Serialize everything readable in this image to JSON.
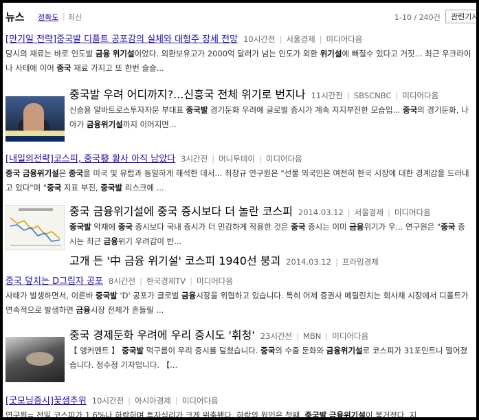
{
  "header": {
    "title": "뉴스",
    "tab_accuracy": "정확도",
    "separator": "|",
    "tab_latest": "최신",
    "result_count": "1-10 / 240건",
    "related_button": "관련기사"
  },
  "items": [
    {
      "title": "[만기일 전략]중국발 디플트 공포감의 실체와 대형주 장세 전망",
      "time": "10시간전",
      "source": "서울경제",
      "via": "미디어다음",
      "desc_parts": [
        {
          "t": "당시의 재료는 바로 인도발 ",
          "b": false
        },
        {
          "t": "금융",
          "b": true
        },
        {
          "t": " ",
          "b": false
        },
        {
          "t": "위기설",
          "b": true
        },
        {
          "t": "이었다. 외환보유고가 2000억 달러가 넘는 인도가 외환 ",
          "b": false
        },
        {
          "t": "위기설",
          "b": true
        },
        {
          "t": "에 빠질수 있다고 거짓... 최근 우크라이나 사태에 이어 ",
          "b": false
        },
        {
          "t": "중국",
          "b": true
        },
        {
          "t": " 재료 가지고 또 한번 슬슬...",
          "b": false
        }
      ]
    },
    {
      "title": "중국발 우려 어디까지?...신흥국 전체 위기로 번지나",
      "time": "11시간전",
      "source": "SBSCNBC",
      "via": "미디어다음",
      "desc_parts": [
        {
          "t": "신승용 알바트로스투자자문 부대표 ",
          "b": false
        },
        {
          "t": "중국발",
          "b": true
        },
        {
          "t": " 경기둔화 우려에 글로벌 증시가 계속 지지부진한 모습입... ",
          "b": false
        },
        {
          "t": "중국",
          "b": true
        },
        {
          "t": "의 경기둔화, 나아가 ",
          "b": false
        },
        {
          "t": "금융위기설",
          "b": true
        },
        {
          "t": "까지 이어지면...",
          "b": false
        }
      ]
    },
    {
      "title": "[내일의전략]코스피, 중국發 황사 아직 남았다",
      "time": "3시간전",
      "source": "머니투데이",
      "via": "미디어다음",
      "desc_parts": [
        {
          "t": "중국",
          "b": true
        },
        {
          "t": " ",
          "b": false
        },
        {
          "t": "금융위기설",
          "b": true
        },
        {
          "t": "은 ",
          "b": false
        },
        {
          "t": "중국",
          "b": true
        },
        {
          "t": "을 미국 및 유럽과 동일하게 해석한 데서... 최창규 연구원은 \"선물 외국인은 여전히 한국 시장에 대한 경계감을 드러내고 있다\"며 \"",
          "b": false
        },
        {
          "t": "중국",
          "b": true
        },
        {
          "t": " 지표 부진, ",
          "b": false
        },
        {
          "t": "중국발",
          "b": true
        },
        {
          "t": " 리스크에 ...",
          "b": false
        }
      ]
    },
    {
      "title": "중국 금융위기설에 중국 증시보다 더 놀란 코스피",
      "time": "2014.03.12",
      "source": "서울경제",
      "via": "미디어다음",
      "desc_parts": [
        {
          "t": "중국발",
          "b": true
        },
        {
          "t": " 악재에 ",
          "b": false
        },
        {
          "t": "중국",
          "b": true
        },
        {
          "t": " 증시보다 국내 증시가 더 민감하게 작용한 것은 ",
          "b": false
        },
        {
          "t": "중국",
          "b": true
        },
        {
          "t": " 증시는 이미 ",
          "b": false
        },
        {
          "t": "금융",
          "b": true
        },
        {
          "t": "위기가 우... 연구원은 \"",
          "b": false
        },
        {
          "t": "중국",
          "b": true
        },
        {
          "t": " 증시는 최근 ",
          "b": false
        },
        {
          "t": "금융",
          "b": true
        },
        {
          "t": "위기 우려감이 반...",
          "b": false
        }
      ],
      "related": {
        "title": "고개 든 '中 금융 위기설' 코스피 1940선 붕괴",
        "time": "2014.03.12",
        "source": "프라임경제"
      }
    },
    {
      "title": "중국 덮치는 D그림자 공포",
      "time": "8시간전",
      "source": "한국경제TV",
      "via": "미디어다음",
      "desc_parts": [
        {
          "t": "사태가 발생하면서, 이른바 ",
          "b": false
        },
        {
          "t": "중국발",
          "b": true
        },
        {
          "t": " 'D' 공포가 글로벌 ",
          "b": false
        },
        {
          "t": "금융",
          "b": true
        },
        {
          "t": "시장을 위협하고 있습니다. 특히 어제 증권사 메릴린치는 회사채 시장에서 디폴트가 연속적으로 발생하면 ",
          "b": false
        },
        {
          "t": "금융",
          "b": true
        },
        {
          "t": "시장 전체가 흔들릴 ...",
          "b": false
        }
      ]
    },
    {
      "title": "중국 경제둔화 우려에 우리 증시도 '휘청'",
      "time": "23시간전",
      "source": "MBN",
      "via": "미디어다음",
      "desc_parts": [
        {
          "t": "【 앵커멘트 】 ",
          "b": false
        },
        {
          "t": "중국발",
          "b": true
        },
        {
          "t": " 먹구름이 우리 증시를 덮쳤습니다. ",
          "b": false
        },
        {
          "t": "중국",
          "b": true
        },
        {
          "t": "의 수출 둔화와 ",
          "b": false
        },
        {
          "t": "금융위기설",
          "b": true
        },
        {
          "t": "로 코스피가 31포인트나 떨어졌습니다. 정수정 기자입니다. 【...",
          "b": false
        }
      ]
    },
    {
      "title": "[굿모닝증시]꽃샘추위",
      "time": "10시간전",
      "source": "아시아경제",
      "via": "미디어다음",
      "desc_parts": [
        {
          "t": "연구원= 전일 코스피가 1.6%나 하락하며 투자심리가 크게 위축됐다. 하락의 원인은 첫째, ",
          "b": false
        },
        {
          "t": "중국발",
          "b": true
        },
        {
          "t": " ",
          "b": false
        },
        {
          "t": "금융위기설",
          "b": true
        },
        {
          "t": "이 불거졌다. 지",
          "b": false
        }
      ]
    }
  ]
}
